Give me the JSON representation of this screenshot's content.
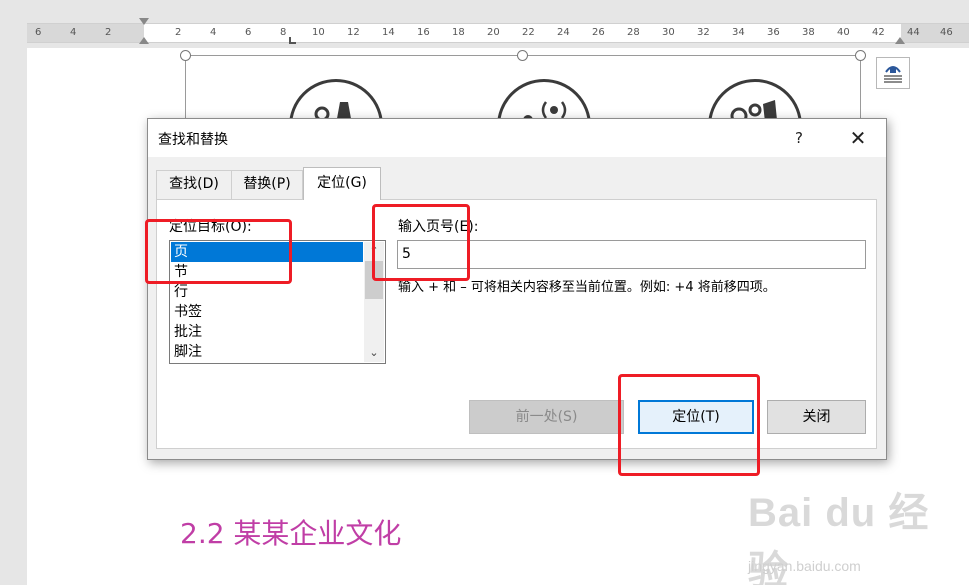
{
  "ruler": {
    "labels": [
      "6",
      "4",
      "2",
      "2",
      "4",
      "6",
      "8",
      "10",
      "12",
      "14",
      "16",
      "18",
      "20",
      "22",
      "24",
      "26",
      "28",
      "30",
      "32",
      "34",
      "36",
      "38",
      "40",
      "42",
      "44",
      "46"
    ]
  },
  "document": {
    "heading": "2.2 某某企业文化"
  },
  "watermark": {
    "logo": "Bai du 经验",
    "url": "jingyan.baidu.com"
  },
  "dialog": {
    "title": "查找和替换",
    "help": "?",
    "close": "✕",
    "tabs": [
      {
        "label": "查找(D)",
        "active": false
      },
      {
        "label": "替换(P)",
        "active": false
      },
      {
        "label": "定位(G)",
        "active": true
      }
    ],
    "goto_target_label": "定位目标(O):",
    "goto_targets": [
      "页",
      "节",
      "行",
      "书签",
      "批注",
      "脚注"
    ],
    "selected_index": 0,
    "page_number_label": "输入页号(E):",
    "page_number_value": "5",
    "hint": "输入 + 和 – 可将相关内容移至当前位置。例如: +4 将前移四项。",
    "buttons": {
      "previous": "前一处(S)",
      "goto": "定位(T)",
      "close": "关闭"
    }
  },
  "colors": {
    "selection": "#0078d7",
    "annotation": "#ee1c25",
    "heading": "#c03ea6"
  }
}
